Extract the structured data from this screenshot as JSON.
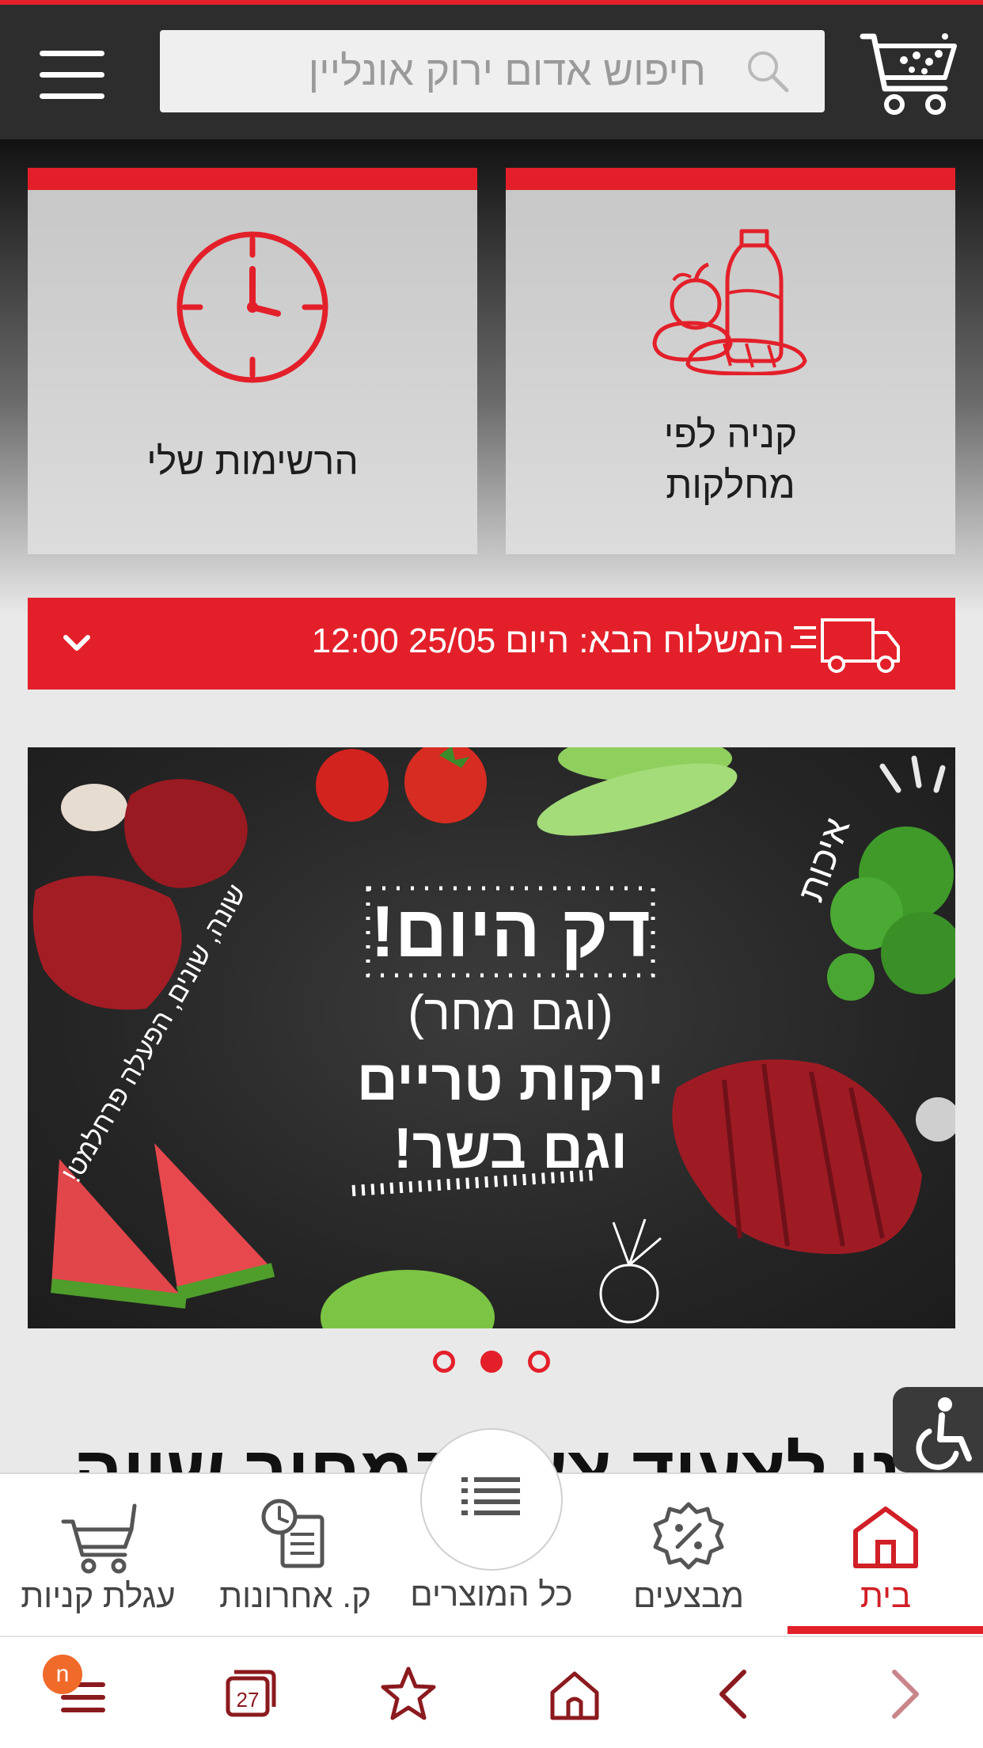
{
  "header": {
    "search_placeholder": "חיפוש אדום ירוק אונליין"
  },
  "tiles": {
    "my_lists": "הרשימות שלי",
    "shop_by_department_line1": "קניה לפי",
    "shop_by_department_line2": "מחלקות"
  },
  "delivery": {
    "text": "המשלוח הבא: היום 25/05 12:00"
  },
  "banner": {
    "headline": "דק היום!",
    "line2": "(וגם מחר)",
    "line3": "ירקות טריים",
    "line4": "וגם בשר!",
    "side_left": "שונה, שונים, הפעלה פרחלמט!",
    "side_right": "איכות"
  },
  "carousel": {
    "active_index": 1,
    "count": 3
  },
  "section_title": "באנו לצעוד צעד במחיר שווה",
  "tabbar": {
    "tabs": [
      {
        "label": "עגלת קניות",
        "icon": "cart-icon"
      },
      {
        "label": "ק. אחרונות",
        "icon": "recent-orders-icon"
      },
      {
        "label": "כל המוצרים",
        "icon": "list-icon"
      },
      {
        "label": "מבצעים",
        "icon": "percent-badge-icon"
      },
      {
        "label": "בית",
        "icon": "home-icon"
      }
    ],
    "active": "בית"
  },
  "browser": {
    "tabs_count": "27",
    "badge": "n"
  },
  "colors": {
    "accent": "#e3202a",
    "header_bg": "#2d2d2d"
  }
}
